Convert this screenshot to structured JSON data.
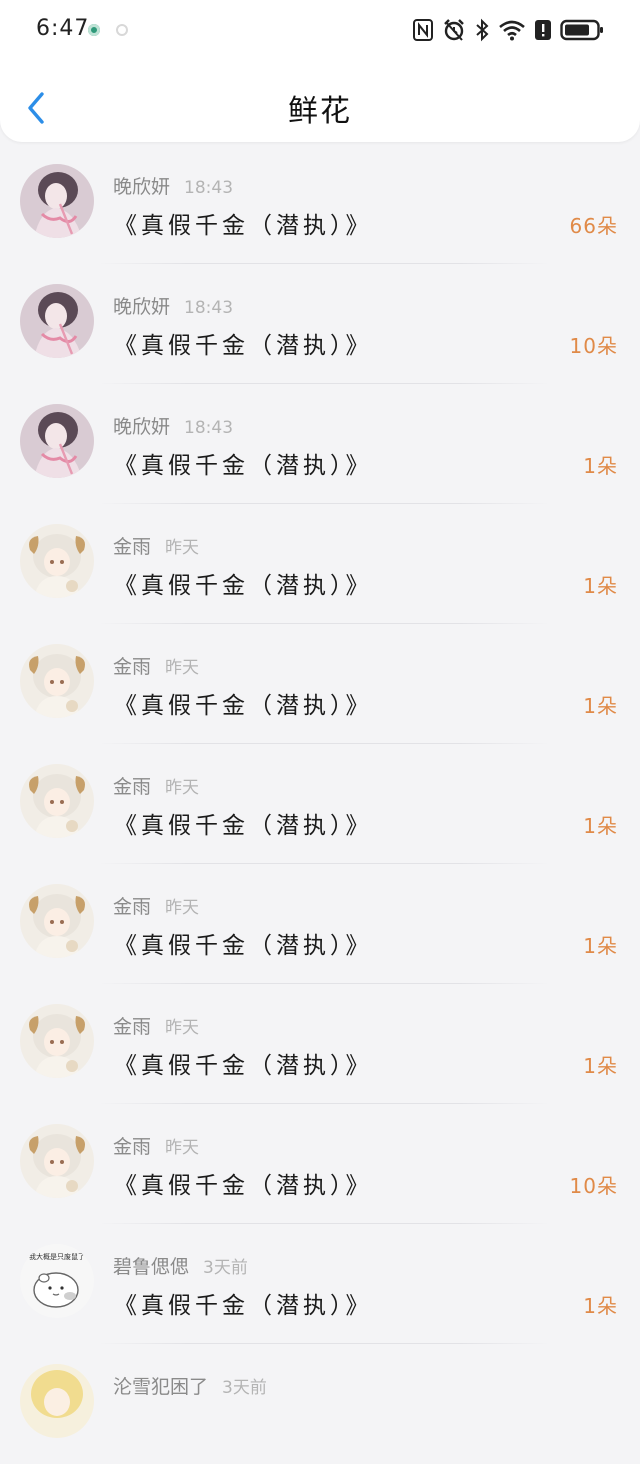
{
  "status_bar": {
    "time": "6:47",
    "icons": [
      "nfc-icon",
      "alarm-icon",
      "bluetooth-icon",
      "wifi-icon",
      "alert-icon",
      "battery-icon"
    ]
  },
  "header": {
    "title": "鲜花",
    "back_icon": "chevron-left-icon",
    "accent_color": "#2c8ee8"
  },
  "rows": [
    {
      "name": "晚欣妍",
      "time": "18:43",
      "book": "《真假千金（潜执）》",
      "count": "66朵",
      "avatar": "girl-portrait"
    },
    {
      "name": "晚欣妍",
      "time": "18:43",
      "book": "《真假千金（潜执）》",
      "count": "10朵",
      "avatar": "girl-portrait"
    },
    {
      "name": "晚欣妍",
      "time": "18:43",
      "book": "《真假千金（潜执）》",
      "count": "1朵",
      "avatar": "girl-portrait"
    },
    {
      "name": "金雨",
      "time": "昨天",
      "book": "《真假千金（潜执）》",
      "count": "1朵",
      "avatar": "sheep-girl"
    },
    {
      "name": "金雨",
      "time": "昨天",
      "book": "《真假千金（潜执）》",
      "count": "1朵",
      "avatar": "sheep-girl"
    },
    {
      "name": "金雨",
      "time": "昨天",
      "book": "《真假千金（潜执）》",
      "count": "1朵",
      "avatar": "sheep-girl"
    },
    {
      "name": "金雨",
      "time": "昨天",
      "book": "《真假千金（潜执）》",
      "count": "1朵",
      "avatar": "sheep-girl"
    },
    {
      "name": "金雨",
      "time": "昨天",
      "book": "《真假千金（潜执）》",
      "count": "1朵",
      "avatar": "sheep-girl"
    },
    {
      "name": "金雨",
      "time": "昨天",
      "book": "《真假千金（潜执）》",
      "count": "10朵",
      "avatar": "sheep-girl"
    },
    {
      "name": "碧鲁偲偲",
      "time": "3天前",
      "book": "《真假千金（潜执）》",
      "count": "1朵",
      "avatar": "hamster-sticker",
      "avatar_text": "我大概是只废鼠了"
    },
    {
      "name": "沦雪犯困了",
      "time": "3天前",
      "book": "",
      "count": "",
      "avatar": "blonde-girl"
    }
  ],
  "colors": {
    "count": "#e08a48",
    "name": "#8a8a8a",
    "time": "#b4b4b4",
    "book": "#1b1b1b",
    "background": "#f4f4f6"
  }
}
